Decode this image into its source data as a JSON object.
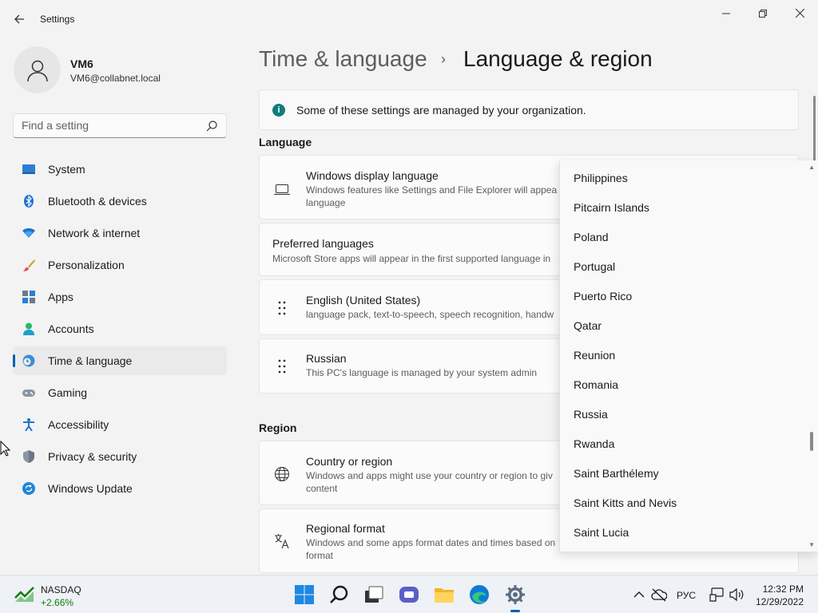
{
  "window": {
    "title": "Settings",
    "back_icon": "arrow-left-icon",
    "minimize_icon": "minimize-icon",
    "maximize_icon": "restore-icon",
    "close_icon": "close-icon"
  },
  "profile": {
    "name": "VM6",
    "email": "VM6@collabnet.local"
  },
  "search": {
    "placeholder": "Find a setting"
  },
  "sidebar": {
    "items": [
      {
        "label": "System",
        "icon": "system-icon",
        "selected": false
      },
      {
        "label": "Bluetooth & devices",
        "icon": "bluetooth-icon",
        "selected": false
      },
      {
        "label": "Network & internet",
        "icon": "wifi-icon",
        "selected": false
      },
      {
        "label": "Personalization",
        "icon": "brush-icon",
        "selected": false
      },
      {
        "label": "Apps",
        "icon": "apps-icon",
        "selected": false
      },
      {
        "label": "Accounts",
        "icon": "person-icon",
        "selected": false
      },
      {
        "label": "Time & language",
        "icon": "globe-clock-icon",
        "selected": true
      },
      {
        "label": "Gaming",
        "icon": "gamepad-icon",
        "selected": false
      },
      {
        "label": "Accessibility",
        "icon": "accessibility-icon",
        "selected": false
      },
      {
        "label": "Privacy & security",
        "icon": "shield-icon",
        "selected": false
      },
      {
        "label": "Windows Update",
        "icon": "update-icon",
        "selected": false
      }
    ]
  },
  "breadcrumb": {
    "parent": "Time & language",
    "separator": "›",
    "current": "Language & region"
  },
  "info_bar": {
    "text": "Some of these settings are managed by your organization."
  },
  "language_section": {
    "heading": "Language",
    "display_language": {
      "title": "Windows display language",
      "subtitle_line1": "Windows features like Settings and File Explorer will appea",
      "subtitle_line2": "language"
    },
    "preferred": {
      "title": "Preferred languages",
      "subtitle": "Microsoft Store apps will appear in the first supported language in"
    },
    "languages": [
      {
        "title": "English (United States)",
        "subtitle": "language pack, text-to-speech, speech recognition, handw"
      },
      {
        "title": "Russian",
        "subtitle": "This PC's language is managed by your system admin"
      }
    ]
  },
  "region_section": {
    "heading": "Region",
    "country": {
      "title": "Country or region",
      "subtitle_line1": "Windows and apps might use your country or region to giv",
      "subtitle_line2": "content"
    },
    "format": {
      "title": "Regional format",
      "subtitle_line1": "Windows and some apps format dates and times based on",
      "subtitle_line2": "format"
    }
  },
  "country_dropdown": {
    "options": [
      "Philippines",
      "Pitcairn Islands",
      "Poland",
      "Portugal",
      "Puerto Rico",
      "Qatar",
      "Reunion",
      "Romania",
      "Russia",
      "Rwanda",
      "Saint Barthélemy",
      "Saint Kitts and Nevis",
      "Saint Lucia"
    ]
  },
  "taskbar": {
    "stock_name": "NASDAQ",
    "stock_change": "+2.66%",
    "language": "РУС",
    "time": "12:32 PM",
    "date": "12/29/2022",
    "pinned": [
      "start-icon",
      "search-icon",
      "task-view-icon",
      "chat-icon",
      "file-explorer-icon",
      "edge-icon",
      "settings-icon"
    ]
  },
  "colors": {
    "accent": "#005fb8",
    "info": "#107c7c",
    "stock_up": "#107c10"
  }
}
